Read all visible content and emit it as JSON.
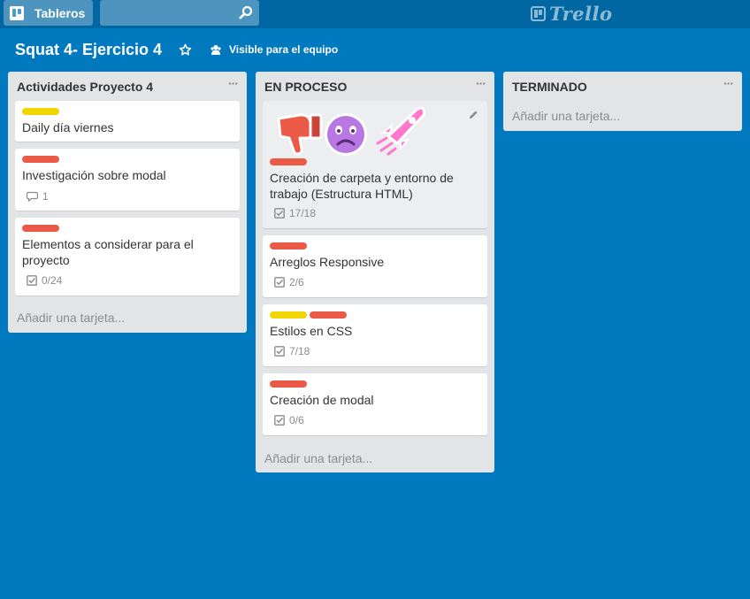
{
  "header": {
    "boards_label": "Tableros",
    "search_value": "",
    "logo_text": "Trello"
  },
  "board": {
    "title": "Squat 4- Ejercicio 4",
    "visibility": "Visible para el equipo"
  },
  "colors": {
    "board_bg": "#0079bf",
    "label_yellow": "#f2d600",
    "label_red": "#eb5a46"
  },
  "lists": [
    {
      "title": "Actividades Proyecto 4",
      "menu": "···",
      "add_card": "Añadir una tarjeta...",
      "cards": [
        {
          "labels": [
            "yellow"
          ],
          "title": "Daily día viernes"
        },
        {
          "labels": [
            "red"
          ],
          "title": "Investigación sobre modal",
          "comments": "1"
        },
        {
          "labels": [
            "red"
          ],
          "title": "Elementos a considerar para el proyecto",
          "checklist": "0/24"
        }
      ]
    },
    {
      "title": "EN PROCESO",
      "menu": "···",
      "add_card": "Añadir una tarjeta...",
      "cards": [
        {
          "stickers": [
            "thumbs-down",
            "frown",
            "rocket"
          ],
          "labels": [
            "red"
          ],
          "title": "Creación de carpeta y entorno de trabajo (Estructura HTML)",
          "checklist": "17/18"
        },
        {
          "labels": [
            "red"
          ],
          "title": "Arreglos Responsive",
          "checklist": "2/6"
        },
        {
          "labels": [
            "yellow",
            "red"
          ],
          "title": "Estilos en CSS",
          "checklist": "7/18"
        },
        {
          "labels": [
            "red"
          ],
          "title": "Creación de modal",
          "checklist": "0/6"
        }
      ]
    },
    {
      "title": "TERMINADO",
      "menu": "···",
      "add_card": "Añadir una tarjeta...",
      "cards": []
    }
  ]
}
